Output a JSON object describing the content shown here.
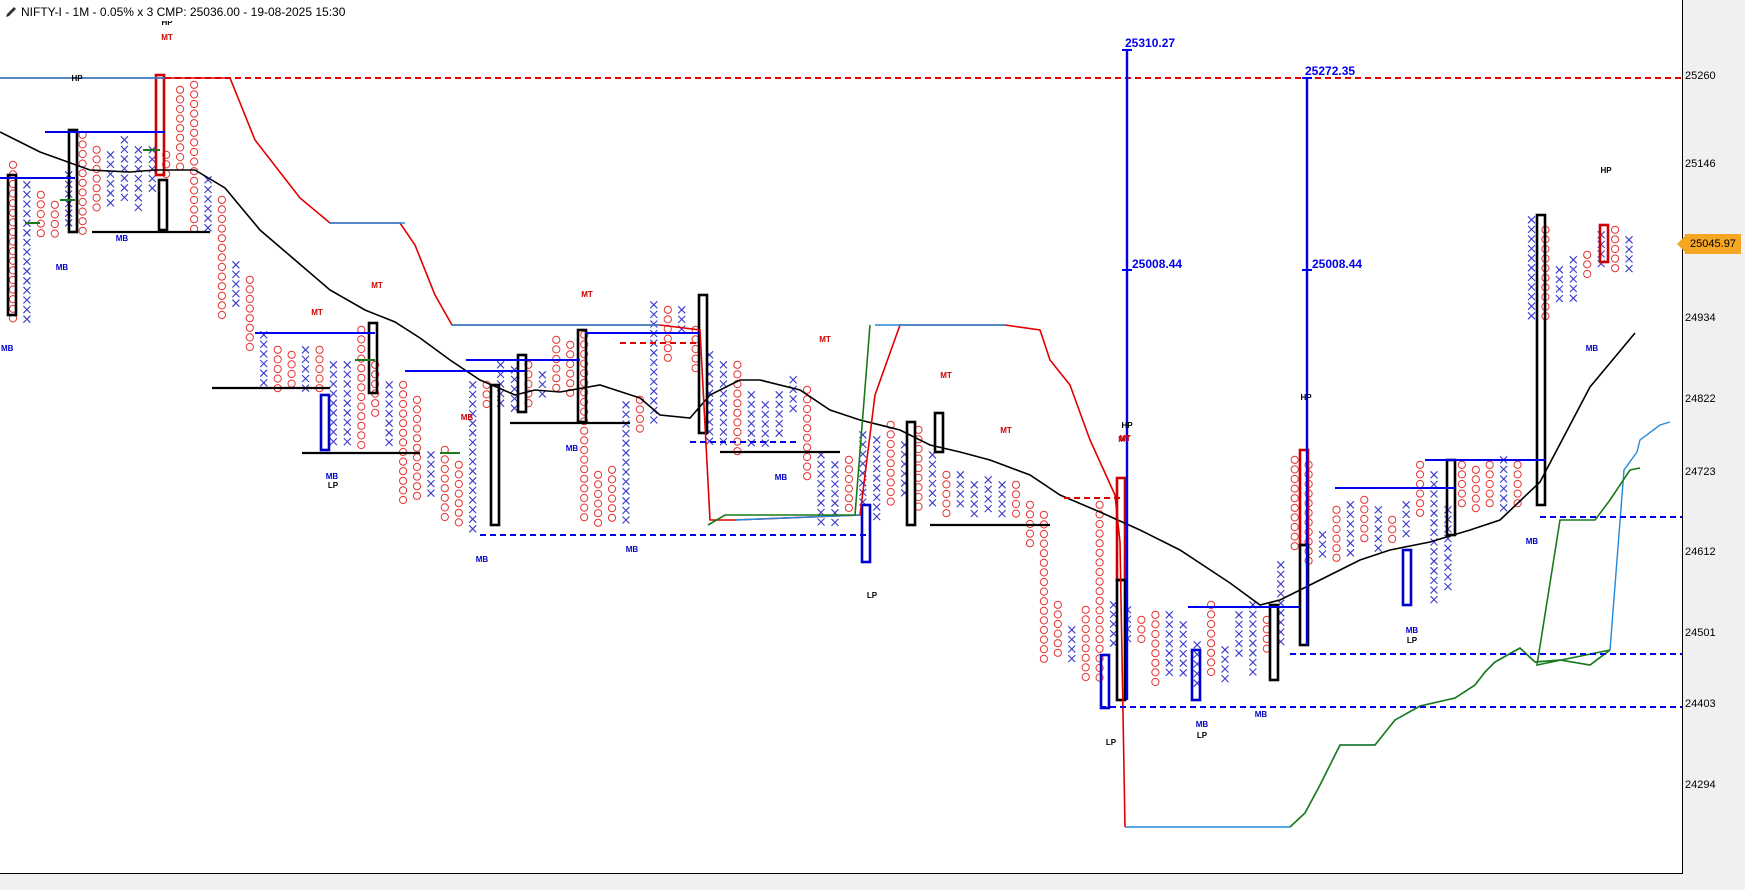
{
  "title": "NIFTY-I - 1M - 0.05% x 3 CMP: 25036.00 - 19-08-2025 15:30",
  "cmp_label": "25045.97",
  "chart_data": {
    "type": "point-and-figure",
    "y_ticks": [
      25260,
      25146,
      24934,
      24822,
      24723,
      24612,
      24501,
      24403,
      24294
    ],
    "price_annotations": [
      "25310.27",
      "25008.44",
      "25272.35",
      "25008.44"
    ],
    "pattern_labels": [
      "HP",
      "MT",
      "MB",
      "MB",
      "MT",
      "MT",
      "MT",
      "MB",
      "LP",
      "MT",
      "MB",
      "MB",
      "MB",
      "MT",
      "MT",
      "MB",
      "LP",
      "MT",
      "HP",
      "MT",
      "LP",
      "MB",
      "LP",
      "MB",
      "HP",
      "MB",
      "LP",
      "MB",
      "HP",
      "MB",
      "MB"
    ],
    "colors": {
      "x_mark": "#3a3acc",
      "o_mark": "#e53333",
      "resistance": "#e00000",
      "support": "#1a7a1a",
      "trend": "#000000",
      "target": "#0000ee"
    }
  }
}
